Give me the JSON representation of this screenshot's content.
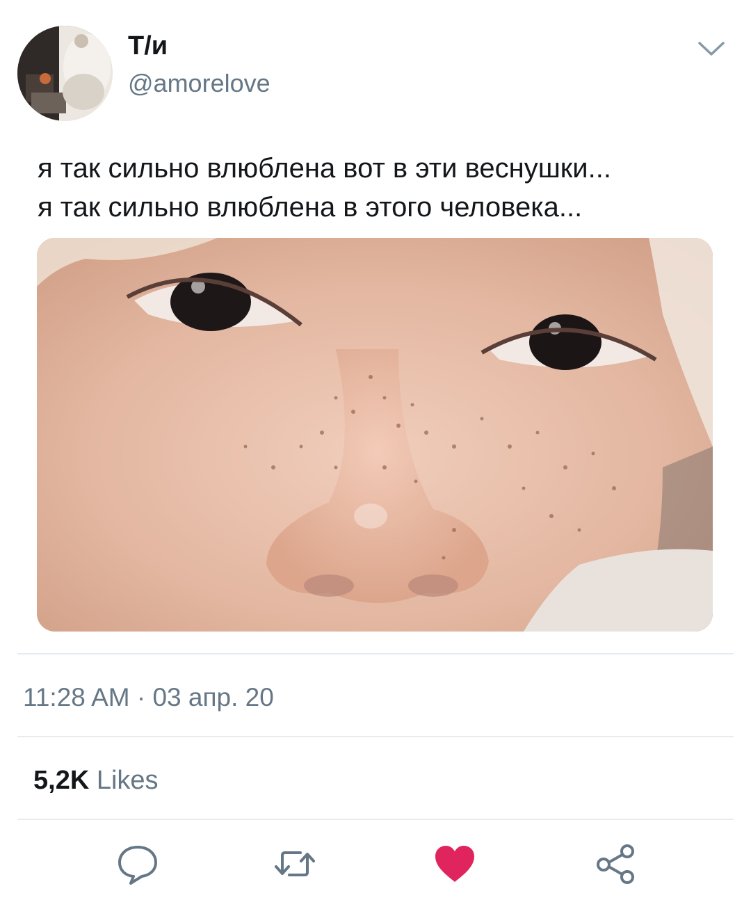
{
  "author": {
    "display_name": "Т/и",
    "handle": "@amorelove",
    "avatar_icon": "profile-photo"
  },
  "tweet": {
    "lines": [
      "я так сильно влюблена вот в эти веснушки...",
      "я так сильно влюблена в этого человека..."
    ],
    "media_icon": "photo-closeup-face-freckles"
  },
  "meta": {
    "timestamp": "11:28 AM · 03 апр. 20"
  },
  "stats": {
    "likes_count": "5,2K",
    "likes_label": "Likes"
  },
  "actions": {
    "reply_icon": "reply-icon",
    "retweet_icon": "retweet-icon",
    "like_icon": "heart-icon",
    "share_icon": "share-icon",
    "like_active": true,
    "like_color": "#e0245e",
    "icon_color": "#657786"
  },
  "colors": {
    "text_primary": "#14171a",
    "text_secondary": "#657786",
    "divider": "#e6ecf0"
  }
}
